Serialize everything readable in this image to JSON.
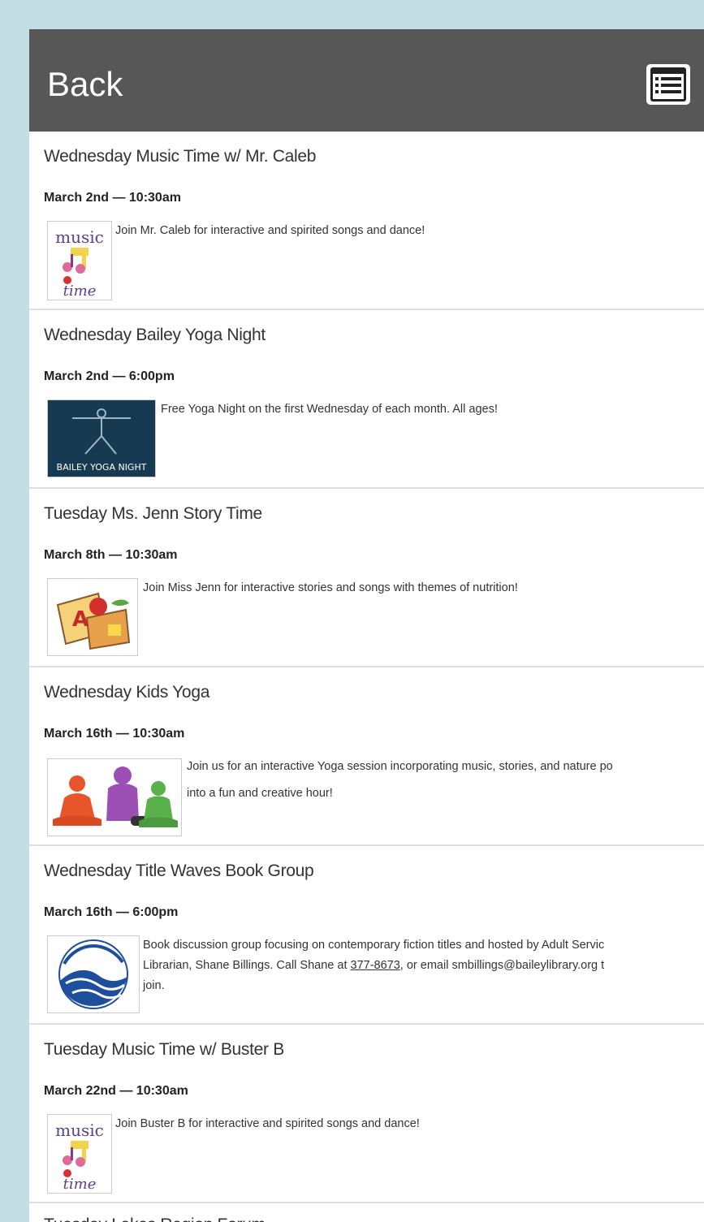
{
  "header": {
    "back_label": "Back",
    "menu_icon": "list-menu-icon"
  },
  "events": [
    {
      "title": "Wednesday Music Time w/ Mr. Caleb",
      "date": "March 2nd — 10:30am",
      "image_icon": "music-time-icon",
      "image_text_top": "music",
      "image_text_bottom": "time",
      "description": "Join Mr. Caleb for interactive and spirited songs and dance!"
    },
    {
      "title": "Wednesday Bailey Yoga Night",
      "date": "March 2nd — 6:00pm",
      "image_icon": "bailey-yoga-night-icon",
      "image_text": "BAILEY YOGA NIGHT",
      "description": "Free Yoga Night on the first Wednesday of each month. All ages!"
    },
    {
      "title": "Tuesday Ms. Jenn Story Time",
      "date": "March 8th — 10:30am",
      "image_icon": "story-time-icon",
      "image_text": "A",
      "description": "Join Miss Jenn for interactive stories and songs with themes of nutrition!"
    },
    {
      "title": "Wednesday Kids Yoga",
      "date": "March 16th — 10:30am",
      "image_icon": "kids-yoga-icon",
      "description_line1": "Join us for an interactive Yoga session incorporating music, stories, and nature po",
      "description_line2": "into a fun and creative hour!"
    },
    {
      "title": "Wednesday Title Waves Book Group",
      "date": "March 16th — 6:00pm",
      "image_icon": "title-waves-logo-icon",
      "description_line1": "Book discussion group focusing on contemporary fiction titles and hosted by Adult Servic",
      "description_line2_a": "Librarian, Shane Billings. Call Shane at ",
      "phone": "377-8673",
      "description_line2_b": ", or email ",
      "email": "smbillings@baileylibrary.org",
      "description_line2_c": " t",
      "description_line3": "join."
    },
    {
      "title": "Tuesday Music Time w/ Buster B",
      "date": "March 22nd — 10:30am",
      "image_icon": "music-time-icon",
      "image_text_top": "music",
      "image_text_bottom": "time",
      "description": "Join Buster B for interactive and spirited songs and dance!"
    },
    {
      "title": "Tuesday Lakes Region Forum"
    }
  ]
}
